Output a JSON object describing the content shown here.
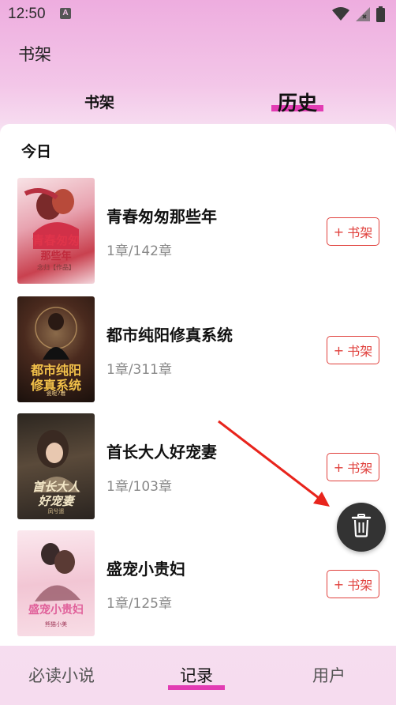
{
  "status_bar": {
    "time": "12:50",
    "notification_icon_letter": "A",
    "icons": [
      "wifi-icon",
      "signal-icon",
      "battery-icon"
    ]
  },
  "app": {
    "title": "书架"
  },
  "tabs": [
    {
      "label": "书架",
      "selected": false
    },
    {
      "label": "历史",
      "selected": true
    }
  ],
  "history": {
    "section_title": "今日",
    "books": [
      {
        "title": "青春匆匆那些年",
        "progress": "1章/142章",
        "add_label": "书架",
        "cover": {
          "line1": "青春匆匆",
          "line2": "那些年",
          "author": "念归【作品】",
          "theme": "#f2c6cd"
        }
      },
      {
        "title": "都市纯阳修真系统",
        "progress": "1章/311章",
        "add_label": "书架",
        "cover": {
          "line1": "都市纯阳",
          "line2": "修真系统",
          "author": "瓷呢?着",
          "theme": "#2a1a14"
        }
      },
      {
        "title": "首长大人好宠妻",
        "progress": "1章/103章",
        "add_label": "书架",
        "cover": {
          "line1": "首长大人",
          "line2": "好宠妻",
          "author": "凤兮遥",
          "theme": "#3a3128"
        }
      },
      {
        "title": "盛宠小贵妇",
        "progress": "1章/125章",
        "add_label": "书架",
        "cover": {
          "line1": "盛宠小贵妇",
          "line2": "",
          "author": "熊猫小美",
          "theme": "#f4d4df"
        }
      }
    ]
  },
  "fab": {
    "icon": "trash-icon"
  },
  "bottom_nav": [
    {
      "label": "必读小说",
      "selected": false
    },
    {
      "label": "记录",
      "selected": true
    },
    {
      "label": "用户",
      "selected": false
    }
  ],
  "colors": {
    "accent_pink": "#e23cb3",
    "add_button_red": "#e0413d",
    "fab_dark": "#333333",
    "arrow_red": "#e8241c"
  }
}
